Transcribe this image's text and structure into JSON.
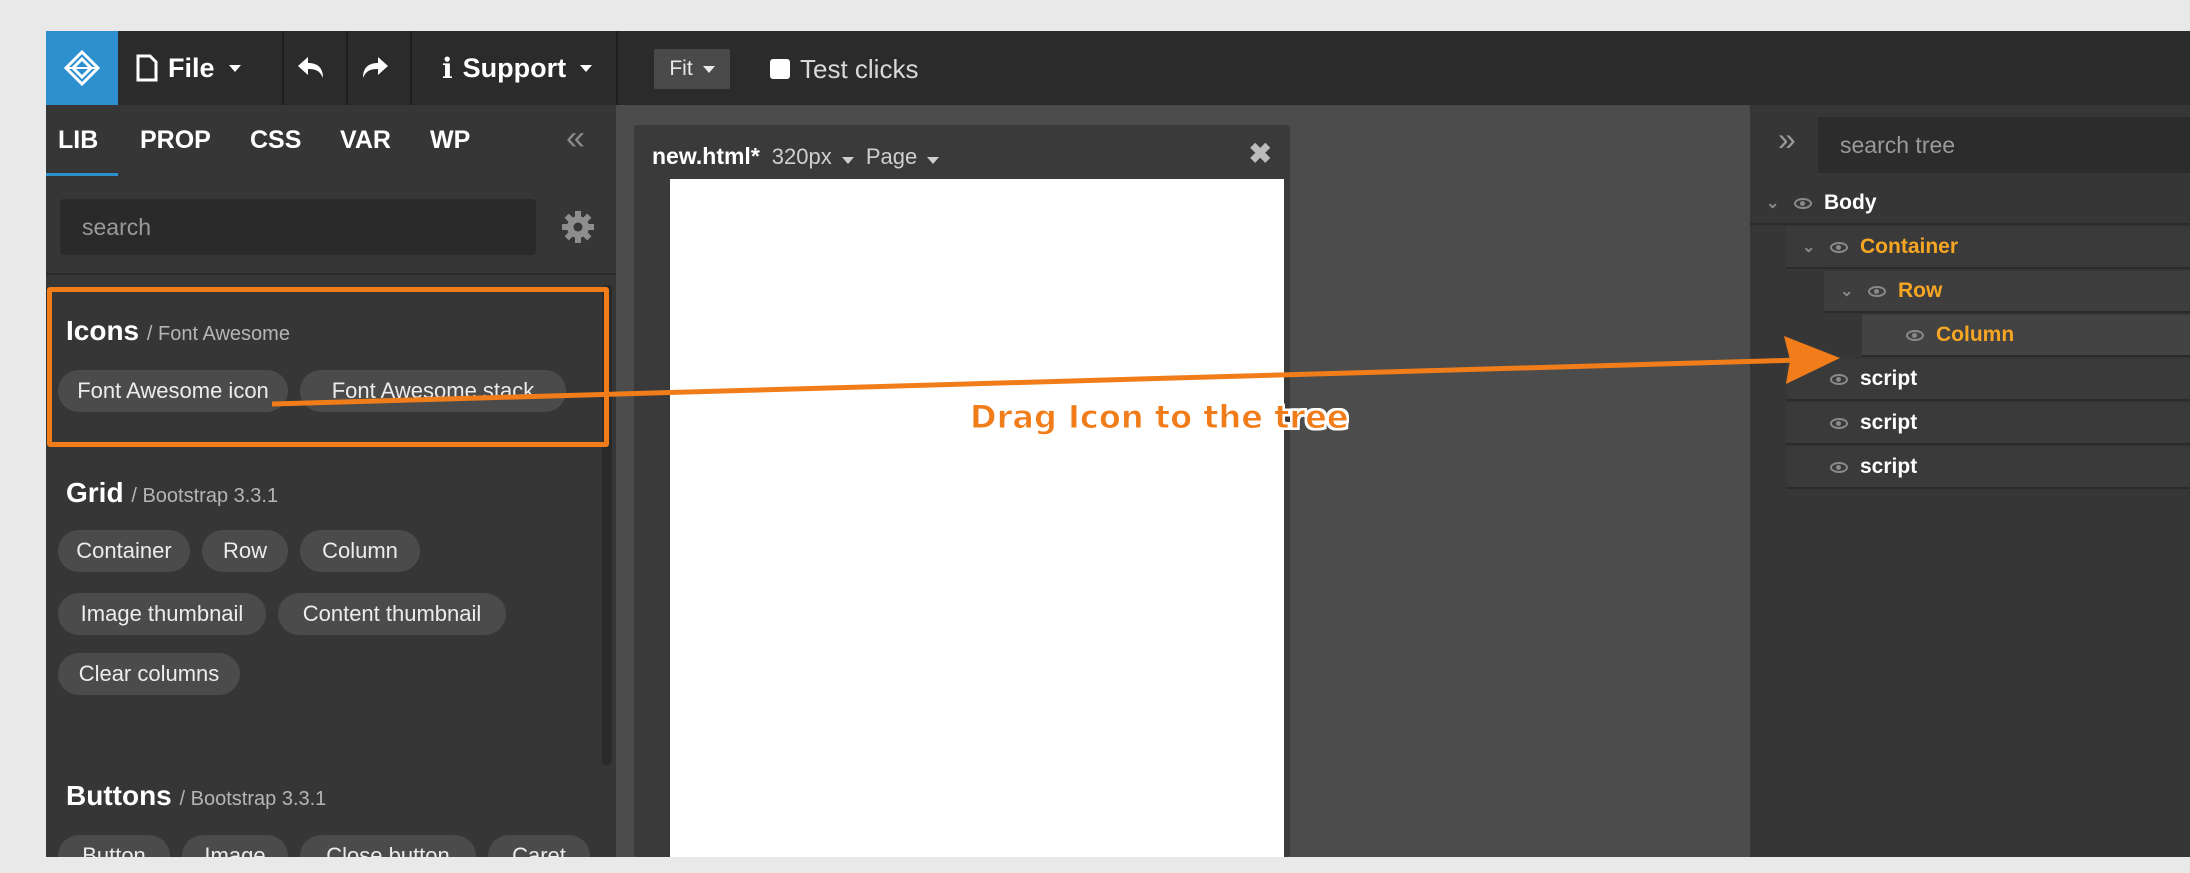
{
  "topbar": {
    "file_label": "File",
    "support_label": "Support",
    "fit_label": "Fit",
    "test_clicks_label": "Test clicks"
  },
  "left_panel": {
    "tabs": [
      "LIB",
      "PROP",
      "CSS",
      "VAR",
      "WP"
    ],
    "search_placeholder": "search",
    "sections": [
      {
        "title": "Icons",
        "subtitle": "/ Font Awesome",
        "items": [
          "Font Awesome icon",
          "Font Awesome stack"
        ]
      },
      {
        "title": "Grid",
        "subtitle": "/ Bootstrap 3.3.1",
        "items": [
          "Container",
          "Row",
          "Column",
          "Image thumbnail",
          "Content thumbnail",
          "Clear columns"
        ]
      },
      {
        "title": "Buttons",
        "subtitle": "/ Bootstrap 3.3.1",
        "items": [
          "Button",
          "Image",
          "Close button",
          "Caret"
        ]
      }
    ]
  },
  "canvas": {
    "filename": "new.html*",
    "width_label": "320px",
    "page_label": "Page",
    "close_glyph": "✖"
  },
  "right_panel": {
    "search_placeholder": "search tree",
    "tree": [
      {
        "label": "Body",
        "selected": false
      },
      {
        "label": "Container",
        "selected": true
      },
      {
        "label": "Row",
        "selected": true
      },
      {
        "label": "Column",
        "selected": true
      },
      {
        "label": "script",
        "selected": false
      },
      {
        "label": "script",
        "selected": false
      },
      {
        "label": "script",
        "selected": false
      }
    ]
  },
  "annotation": {
    "label": "Drag Icon to the tree",
    "color": "#f07d1a"
  },
  "colors": {
    "accent": "#2e8fcf",
    "selected_node": "#f6a623"
  }
}
